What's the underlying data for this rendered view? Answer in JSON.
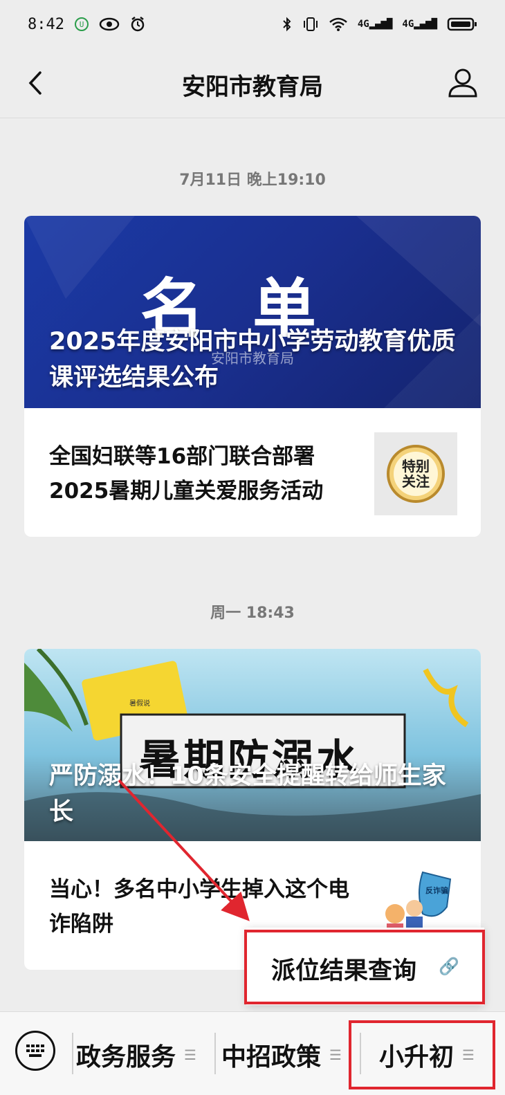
{
  "status_bar": {
    "time": "8:42",
    "battery_icon": "battery-icon",
    "network": "4G"
  },
  "nav": {
    "title": "安阳市教育局"
  },
  "feed": [
    {
      "timestamp": "7月11日 晚上19:10",
      "cover": {
        "big_word": "名单",
        "watermark": "安阳市教育局",
        "title": "2025年度安阳市中小学劳动教育优质课评选结果公布"
      },
      "sub": {
        "title": "全国妇联等16部门联合部署2025暑期儿童关爱服务活动",
        "thumb_text": "特别关注"
      }
    },
    {
      "timestamp": "周一 18:43",
      "cover": {
        "big_word": "暑期防溺水",
        "tag": "暑假说",
        "title": "严防溺水！10条安全提醒转给师生家长"
      },
      "sub": {
        "title": "当心！多名中小学生掉入这个电诈陷阱",
        "thumb_text": "反诈骗"
      }
    }
  ],
  "popup": {
    "label": "派位结果查询"
  },
  "menu": {
    "items": [
      {
        "label": "政务服务"
      },
      {
        "label": "中招政策"
      },
      {
        "label": "小升初"
      }
    ]
  },
  "colors": {
    "accent_red": "#e0262f",
    "cover1_bg": "#1a2f8f"
  }
}
